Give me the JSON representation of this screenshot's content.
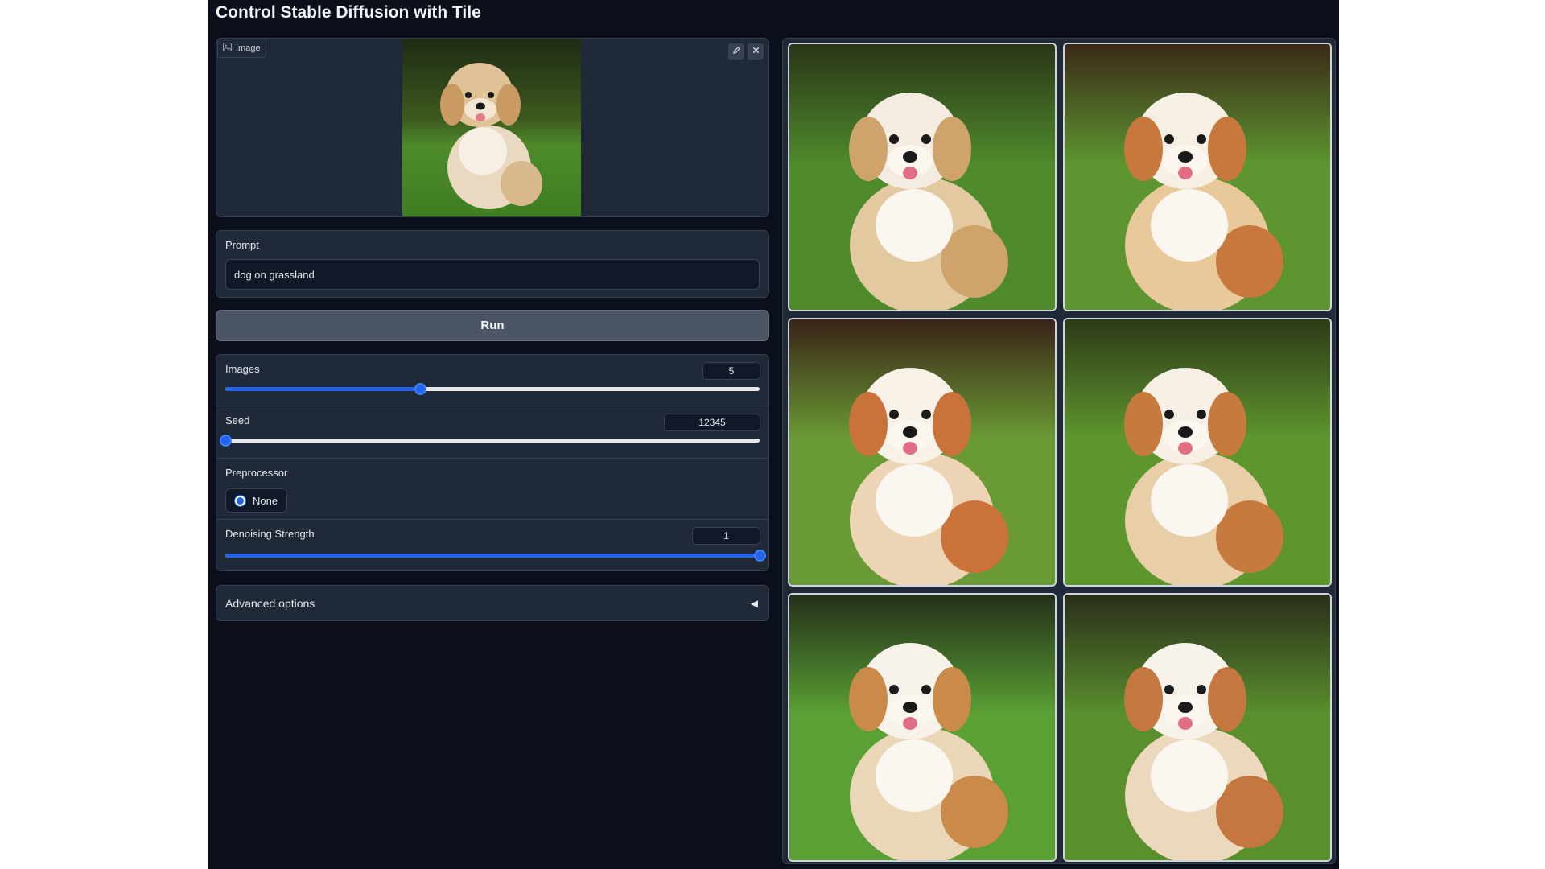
{
  "app": {
    "title": "Control Stable Diffusion with Tile"
  },
  "image_input": {
    "label": "Image",
    "label_icon": "image-icon",
    "edit_icon": "pencil-icon",
    "clear_icon": "close-icon"
  },
  "prompt": {
    "label": "Prompt",
    "value": "dog on grassland"
  },
  "run_button": {
    "label": "Run"
  },
  "images_slider": {
    "label": "Images",
    "value": "5",
    "fraction": 0.364
  },
  "seed_slider": {
    "label": "Seed",
    "value": "12345",
    "fraction": 0.0
  },
  "preprocessor": {
    "label": "Preprocessor",
    "options": [
      "None"
    ],
    "selected": "None"
  },
  "denoising_slider": {
    "label": "Denoising Strength",
    "value": "1",
    "fraction": 1.0
  },
  "advanced_options": {
    "label": "Advanced options",
    "toggle_icon": "caret-left-icon"
  },
  "gallery": {
    "count": 6
  },
  "colors": {
    "background": "#0b0f19",
    "panel": "#1f2937",
    "border": "#374151",
    "accent": "#2563eb",
    "button": "#4b5563"
  }
}
